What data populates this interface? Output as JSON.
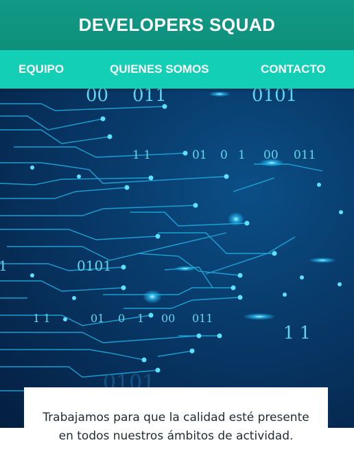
{
  "header": {
    "title": "DEVELOPERS SQUAD"
  },
  "nav": {
    "items": [
      {
        "label": "EQUIPO"
      },
      {
        "label": "QUIENES SOMOS"
      },
      {
        "label": "CONTACTO"
      }
    ]
  },
  "hero": {
    "binary_texts": [
      "00",
      "011",
      "0101",
      "1 1",
      "01",
      "0",
      "1",
      "00",
      "011",
      "1",
      "0101",
      "1 1",
      "01",
      "0",
      "1",
      "00",
      "011",
      "1 1",
      "0101"
    ]
  },
  "caption": {
    "text": "Trabajamos para que la calidad esté presente en todos nuestros ámbitos de actividad."
  },
  "colors": {
    "header": "#0e8f7c",
    "nav": "#13cfb6",
    "hero": "#062a52",
    "circuit": "#1fb3e6"
  }
}
